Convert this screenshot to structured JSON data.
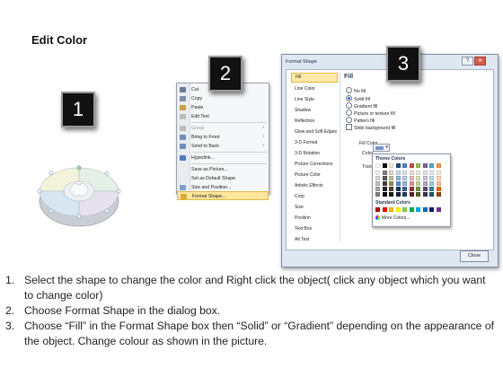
{
  "page_title": "Edit Color",
  "steps": [
    "1",
    "2",
    "3"
  ],
  "context_menu": {
    "items": [
      {
        "label": "Cut",
        "icon": "scissors-icon",
        "icon_color": "#6b7b8f"
      },
      {
        "label": "Copy",
        "icon": "copy-icon",
        "icon_color": "#7d8ea3"
      },
      {
        "label": "Paste",
        "icon": "paste-icon",
        "icon_color": "#c8a246"
      },
      {
        "label": "Edit Text",
        "icon": "edit-text-icon",
        "icon_color": "#bbbbbb"
      },
      {
        "label": "Group",
        "icon": "group-icon",
        "icon_color": "#bcbcbc",
        "disabled": true,
        "submenu": true
      },
      {
        "label": "Bring to Front",
        "icon": "bring-to-front-icon",
        "icon_color": "#6f8fb9",
        "submenu": true
      },
      {
        "label": "Send to Back",
        "icon": "send-to-back-icon",
        "icon_color": "#6f8fb9",
        "submenu": true
      },
      {
        "label": "Hyperlink...",
        "icon": "hyperlink-icon",
        "icon_color": "#4a7bc0"
      },
      {
        "label": "Save as Picture...",
        "icon": "",
        "icon_color": ""
      },
      {
        "label": "Set as Default Shape",
        "icon": "",
        "icon_color": ""
      },
      {
        "label": "Size and Position...",
        "icon": "size-position-icon",
        "icon_color": "#7f9ec6"
      },
      {
        "label": "Format Shape...",
        "icon": "format-shape-icon",
        "icon_color": "#d9a93a",
        "highlighted": true
      }
    ]
  },
  "dialog": {
    "title": "Format Shape",
    "nav": [
      "Fill",
      "Line Color",
      "Line Style",
      "Shadow",
      "Reflection",
      "Glow and Soft Edges",
      "3-D Format",
      "3-D Rotation",
      "Picture Corrections",
      "Picture Color",
      "Artistic Effects",
      "Crop",
      "Size",
      "Position",
      "Text Box",
      "Alt Text"
    ],
    "nav_selected": 0,
    "fill_header": "Fill",
    "options": [
      {
        "label": "No fill",
        "type": "radio",
        "checked": false
      },
      {
        "label": "Solid fill",
        "type": "radio",
        "checked": true
      },
      {
        "label": "Gradient fill",
        "type": "radio",
        "checked": false
      },
      {
        "label": "Picture or texture fill",
        "type": "radio",
        "checked": false
      },
      {
        "label": "Pattern fill",
        "type": "radio",
        "checked": false
      },
      {
        "label": "Slide background fill",
        "type": "checkbox",
        "checked": false
      }
    ],
    "fill_color_label": "Fill Color",
    "color_label": "Color:",
    "transparency_label": "Transpar",
    "close_label": "Close",
    "current_color": "#6f95c7"
  },
  "palette": {
    "theme_label": "Theme Colors",
    "standard_label": "Standard Colors",
    "more_label": "More Colors...",
    "theme_top": [
      "#ffffff",
      "#000000",
      "#eeece1",
      "#1f497d",
      "#4f81bd",
      "#c0504d",
      "#9bbb59",
      "#8064a2",
      "#4bacc6",
      "#f79646"
    ],
    "theme_shades": [
      [
        "#f2f2f2",
        "#7f7f7f",
        "#ddd9c3",
        "#c6d9f0",
        "#dbe5f1",
        "#f2dcdb",
        "#ebf1dd",
        "#e5e0ec",
        "#dbeef3",
        "#fdeada"
      ],
      [
        "#d8d8d8",
        "#595959",
        "#c4bd97",
        "#8db3e2",
        "#b8cce4",
        "#e5b9b7",
        "#d7e3bc",
        "#ccc1d9",
        "#b7dde8",
        "#fbd5b5"
      ],
      [
        "#bfbfbf",
        "#3f3f3f",
        "#938953",
        "#548dd4",
        "#95b3d7",
        "#d99694",
        "#c3d69b",
        "#b2a2c7",
        "#92cddc",
        "#fac08f"
      ],
      [
        "#a5a5a5",
        "#262626",
        "#494429",
        "#17365d",
        "#366092",
        "#953734",
        "#76923c",
        "#5f497a",
        "#31859b",
        "#e36c09"
      ],
      [
        "#7f7f7f",
        "#0c0c0c",
        "#1d1b10",
        "#0f243e",
        "#244061",
        "#632423",
        "#4f6128",
        "#3f3151",
        "#205867",
        "#974806"
      ]
    ],
    "standard": [
      "#c00000",
      "#ff0000",
      "#ffc000",
      "#ffff00",
      "#92d050",
      "#00b050",
      "#00b0f0",
      "#0070c0",
      "#002060",
      "#7030a0"
    ]
  },
  "instructions": [
    {
      "num": "1.",
      "text": "Select the shape to change the color and Right click the object( click any object which you want to change color)"
    },
    {
      "num": "2.",
      "text": "Choose Format Shape in the dialog box."
    },
    {
      "num": "3.",
      "text": "Choose “Fill” in the Format Shape box then “Solid” or “Gradient” depending on the appearance of the object. Change colour as shown in the picture."
    }
  ],
  "donut_colors": {
    "tl": "#f3f3dc",
    "tr": "#e4efe6",
    "bl": "#d7e6f1",
    "br": "#e7e1ef",
    "edge": "#c7ccd2"
  }
}
